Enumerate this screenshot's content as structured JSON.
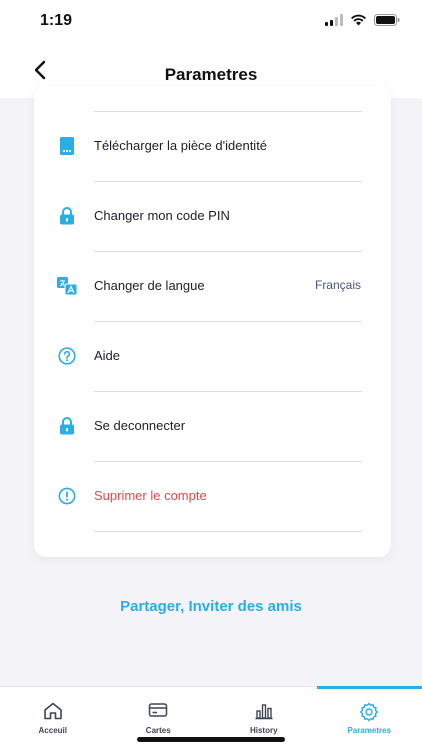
{
  "status_bar": {
    "time": "1:19"
  },
  "header": {
    "title": "Parametres"
  },
  "settings": [
    {
      "label": "Télécharger la pièce d'identité",
      "icon": "id-card-icon"
    },
    {
      "label": "Changer mon code PIN",
      "icon": "lock-icon"
    },
    {
      "label": "Changer de langue",
      "value": "Français",
      "icon": "translate-icon"
    },
    {
      "label": "Aide",
      "icon": "help-icon"
    },
    {
      "label": "Se deconnecter",
      "icon": "lock-icon"
    },
    {
      "label": "Suprimer le compte",
      "icon": "alert-icon"
    }
  ],
  "share": {
    "label": "Partager, Inviter des amis"
  },
  "tabs": [
    {
      "label": "Acceuil",
      "icon": "home-icon",
      "active": false
    },
    {
      "label": "Cartes",
      "icon": "card-icon",
      "active": false
    },
    {
      "label": "History",
      "icon": "bar-chart-icon",
      "active": false
    },
    {
      "label": "Parametres",
      "icon": "gear-icon",
      "active": true
    }
  ],
  "colors": {
    "accent": "#29aee6",
    "danger": "#e8474a",
    "background": "#f4f4f8"
  }
}
